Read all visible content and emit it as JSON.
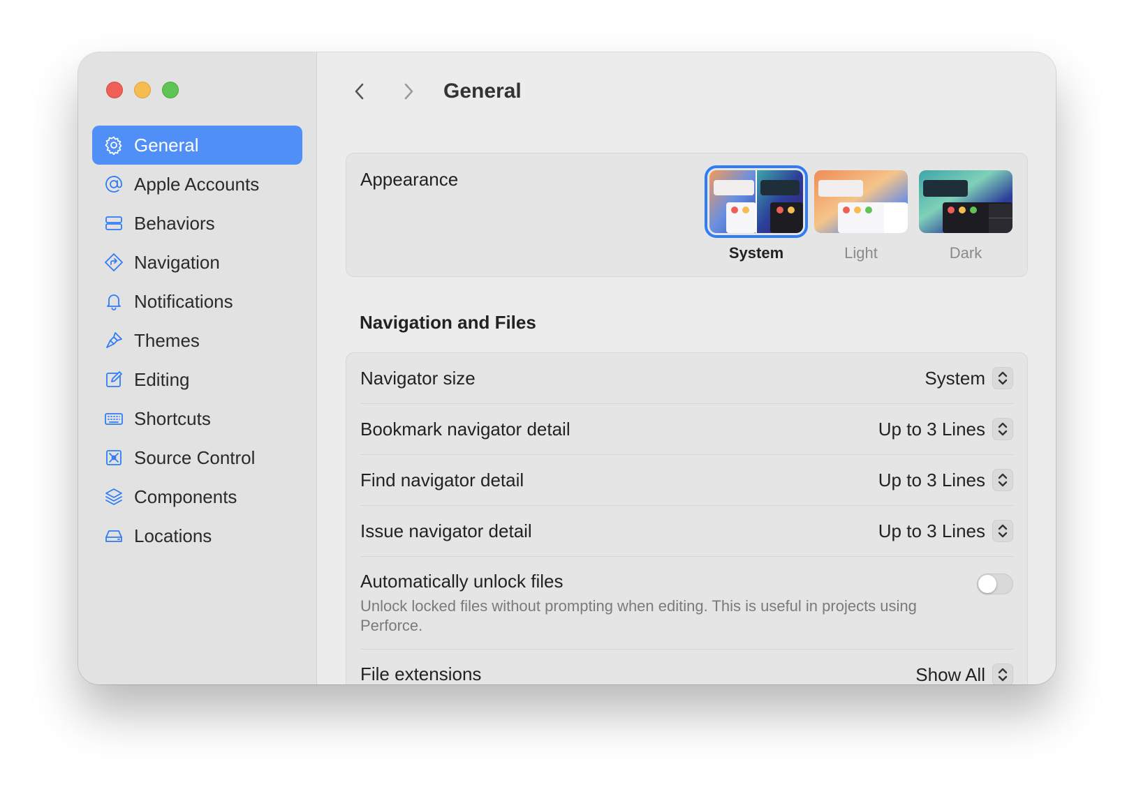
{
  "window": {
    "title": "General"
  },
  "sidebar": {
    "items": [
      {
        "label": "General",
        "icon": "gear-icon",
        "active": true
      },
      {
        "label": "Apple Accounts",
        "icon": "at-sign-icon"
      },
      {
        "label": "Behaviors",
        "icon": "behaviors-icon"
      },
      {
        "label": "Navigation",
        "icon": "navigation-icon"
      },
      {
        "label": "Notifications",
        "icon": "bell-icon"
      },
      {
        "label": "Themes",
        "icon": "paintbrush-icon"
      },
      {
        "label": "Editing",
        "icon": "edit-icon"
      },
      {
        "label": "Shortcuts",
        "icon": "keyboard-icon"
      },
      {
        "label": "Source Control",
        "icon": "source-control-icon"
      },
      {
        "label": "Components",
        "icon": "layers-icon"
      },
      {
        "label": "Locations",
        "icon": "drive-icon"
      }
    ]
  },
  "appearance": {
    "label": "Appearance",
    "options": [
      {
        "name": "System",
        "selected": true
      },
      {
        "name": "Light",
        "selected": false
      },
      {
        "name": "Dark",
        "selected": false
      }
    ]
  },
  "navigation_files": {
    "title": "Navigation and Files",
    "rows": [
      {
        "label": "Navigator size",
        "value": "System"
      },
      {
        "label": "Bookmark navigator detail",
        "value": "Up to 3 Lines"
      },
      {
        "label": "Find navigator detail",
        "value": "Up to 3 Lines"
      },
      {
        "label": "Issue navigator detail",
        "value": "Up to 3 Lines"
      }
    ],
    "auto_unlock": {
      "label": "Automatically unlock files",
      "description": "Unlock locked files without prompting when editing. This is useful in projects using Perforce.",
      "enabled": false
    },
    "file_extensions": {
      "label": "File extensions",
      "value": "Show All"
    }
  },
  "colors": {
    "accent": "#2f7cf6",
    "selection": "#4f8ff7"
  }
}
